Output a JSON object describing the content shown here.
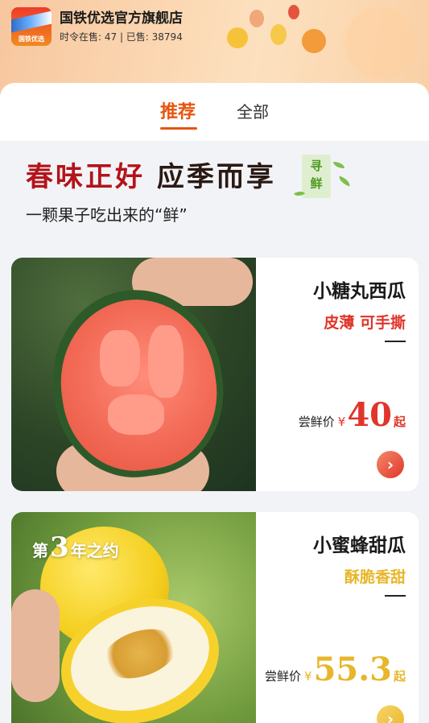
{
  "store": {
    "logo_text": "国铁优选",
    "name": "国铁优选官方旗舰店",
    "stats": "时令在售: 47 | 已售: 38794"
  },
  "tabs": [
    {
      "label": "推荐",
      "active": true
    },
    {
      "label": "全部",
      "active": false
    }
  ],
  "banner": {
    "title_part1": "春味正好",
    "title_part2": "应季而享",
    "seal_line1": "寻",
    "seal_line2": "鲜",
    "subtitle": "一颗果子吃出来的“鲜”"
  },
  "products": [
    {
      "name": "小糖丸西瓜",
      "tagline": "皮薄 可手撕",
      "price_label": "尝鲜价",
      "currency": "¥",
      "price": "40",
      "price_suffix": "起",
      "accent_color": "#e0352b",
      "arrow_icon": "chevron-right-icon"
    },
    {
      "name": "小蜜蜂甜瓜",
      "tagline": "酥脆香甜",
      "badge_prefix": "第",
      "badge_number": "3",
      "badge_suffix": "年之约",
      "price_label": "尝鲜价",
      "currency": "¥",
      "price": "55.3",
      "price_suffix": "起",
      "accent_color": "#e8b62a",
      "arrow_icon": "chevron-right-icon"
    }
  ],
  "colors": {
    "tab_active": "#e8540f",
    "banner_red": "#b3141a",
    "seal_green": "#4c9a1f"
  }
}
